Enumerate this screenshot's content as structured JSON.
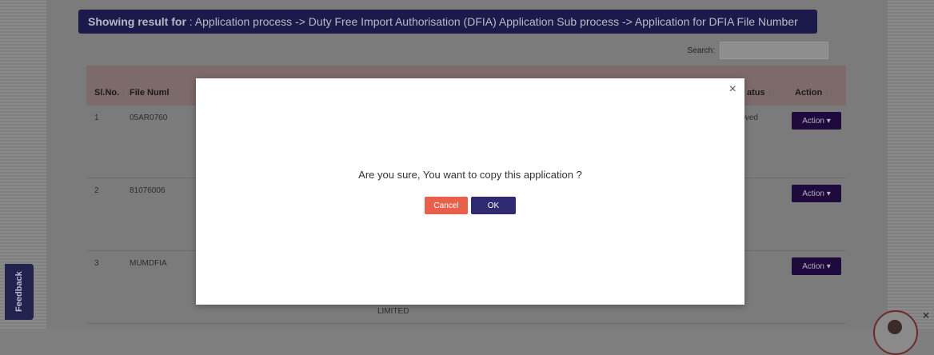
{
  "banner": {
    "label": "Showing result for",
    "path": " : Application process -> Duty Free Import Authorisation (DFIA) Application Sub process -> Application for DFIA File Number"
  },
  "search": {
    "label": "Search:",
    "value": ""
  },
  "table": {
    "headers": {
      "sl": "Sl.No.",
      "file_number": "File Numl",
      "status": "atus",
      "action": "Action"
    },
    "rows": [
      {
        "sl": "1",
        "file_number": "05AR0760",
        "status": "pproved",
        "extra": ""
      },
      {
        "sl": "2",
        "file_number": "81076006",
        "status": "",
        "extra": ""
      },
      {
        "sl": "3",
        "file_number": "MUMDFIA",
        "status": "",
        "extra": "LIMITED"
      }
    ],
    "action_label": "Action ▾"
  },
  "feedback_label": "Feedback",
  "modal": {
    "close": "×",
    "message": "Are you sure, You want to copy this application ?",
    "cancel_label": "Cancel",
    "ok_label": "OK"
  },
  "chat_close": "×"
}
